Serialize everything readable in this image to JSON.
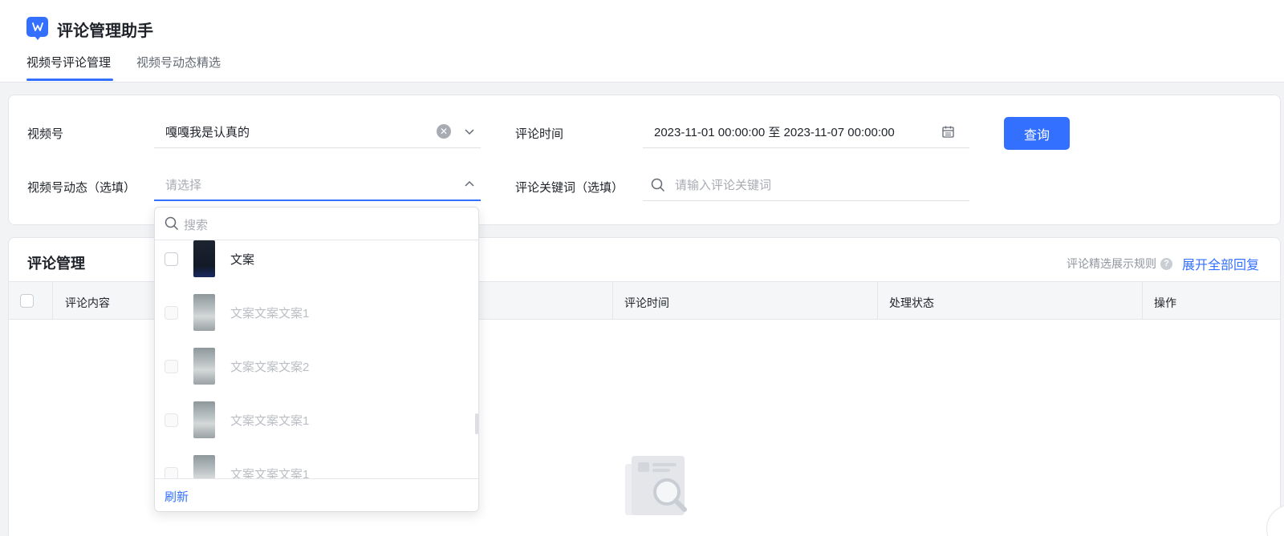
{
  "app": {
    "title": "评论管理助手"
  },
  "tabs": [
    {
      "label": "视频号评论管理",
      "active": true
    },
    {
      "label": "视频号动态精选",
      "active": false
    }
  ],
  "filters": {
    "channel_label": "视频号",
    "channel_value": "嘎嘎我是认真的",
    "post_label": "视频号动态（选填）",
    "post_placeholder": "请选择",
    "time_label": "评论时间",
    "time_value": "2023-11-01 00:00:00 至 2023-11-07 00:00:00",
    "keyword_label": "评论关键词（选填）",
    "keyword_placeholder": "请输入评论关键词",
    "query_button": "查询"
  },
  "dropdown": {
    "search_placeholder": "搜索",
    "items": [
      {
        "label": "文案",
        "enabled": true
      },
      {
        "label": "文案文案文案1",
        "enabled": false
      },
      {
        "label": "文案文案文案2",
        "enabled": false
      },
      {
        "label": "文案文案文案1",
        "enabled": false
      },
      {
        "label": "文案文案文案1",
        "enabled": false
      }
    ],
    "refresh_label": "刷新"
  },
  "comments": {
    "title": "评论管理",
    "rule_link": "评论精选展示规则",
    "expand_link": "展开全部回复",
    "columns": [
      "评论内容",
      "评论时间",
      "处理状态",
      "操作"
    ]
  },
  "colors": {
    "accent": "#3370ff",
    "background": "#f2f3f5"
  }
}
